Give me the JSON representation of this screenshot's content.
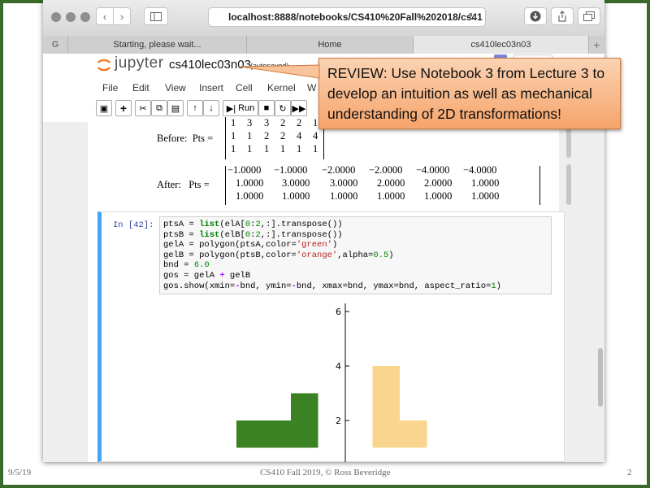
{
  "browser": {
    "url": "localhost:8888/notebooks/CS410%20Fall%202018/cs41",
    "tabs": [
      "Starting, please wait...",
      "Home",
      "cs410lec03n03"
    ],
    "new_tab": "+",
    "left_glyph": "G"
  },
  "jupyter": {
    "logo": "jupyter",
    "notebook_name": "cs410lec03n03",
    "save_status": "(autosaved)",
    "menu": [
      "File",
      "Edit",
      "View",
      "Insert",
      "Cell",
      "Kernel",
      "W"
    ],
    "run_label": "Run"
  },
  "callout": {
    "text": "REVIEW: Use Notebook 3 from Lecture 3 to develop an intuition as well as mechanical understanding of 2D transformations!"
  },
  "output_before": {
    "label": "Before:  Pts =",
    "rows": [
      [
        "1",
        "3",
        "3",
        "2",
        "2",
        "1"
      ],
      [
        "1",
        "1",
        "2",
        "2",
        "4",
        "4"
      ],
      [
        "1",
        "1",
        "1",
        "1",
        "1",
        "1"
      ]
    ]
  },
  "output_after": {
    "label": "After:   Pts =",
    "rows": [
      [
        "−1.0000",
        "−1.0000",
        "−2.0000",
        "−2.0000",
        "−4.0000",
        "−4.0000"
      ],
      [
        "1.0000",
        "3.0000",
        "3.0000",
        "2.0000",
        "2.0000",
        "1.0000"
      ],
      [
        "1.0000",
        "1.0000",
        "1.0000",
        "1.0000",
        "1.0000",
        "1.0000"
      ]
    ]
  },
  "cell": {
    "prompt": "In [42]:",
    "code": [
      "ptsA = list(elA[0:2,:].transpose())",
      "ptsB = list(elB[0:2,:].transpose())",
      "gelA = polygon(ptsA,color='green')",
      "gelB = polygon(ptsB,color='orange',alpha=0.5)",
      "bnd = 6.0",
      "gos = gelA + gelB",
      "gos.show(xmin=-bnd, ymin=-bnd, xmax=bnd, ymax=bnd, aspect_ratio=1)"
    ]
  },
  "colors": {
    "green_shape": "#3b8224",
    "orange_shape": "#f9d58e",
    "frame": "#3a6b2a",
    "callout": "#f6a46a"
  },
  "chart_data": {
    "type": "area",
    "y_tick_labels": [
      "6",
      "4",
      "2"
    ],
    "ylim": [
      0,
      6
    ],
    "xlim": [
      -6,
      6
    ],
    "series": [
      {
        "color": "green",
        "points": [
          [
            -1,
            1
          ],
          [
            -1,
            3
          ],
          [
            -2,
            3
          ],
          [
            -2,
            2
          ],
          [
            -4,
            2
          ],
          [
            -4,
            1
          ]
        ]
      },
      {
        "color": "orange",
        "alpha": 0.5,
        "points": [
          [
            1,
            1
          ],
          [
            3,
            1
          ],
          [
            3,
            2
          ],
          [
            2,
            2
          ],
          [
            2,
            4
          ],
          [
            1,
            4
          ]
        ]
      }
    ]
  },
  "slide_footer": {
    "date": "9/5/19",
    "credit": "CS410 Fall 2019, © Ross Beveridge",
    "page": "2"
  }
}
